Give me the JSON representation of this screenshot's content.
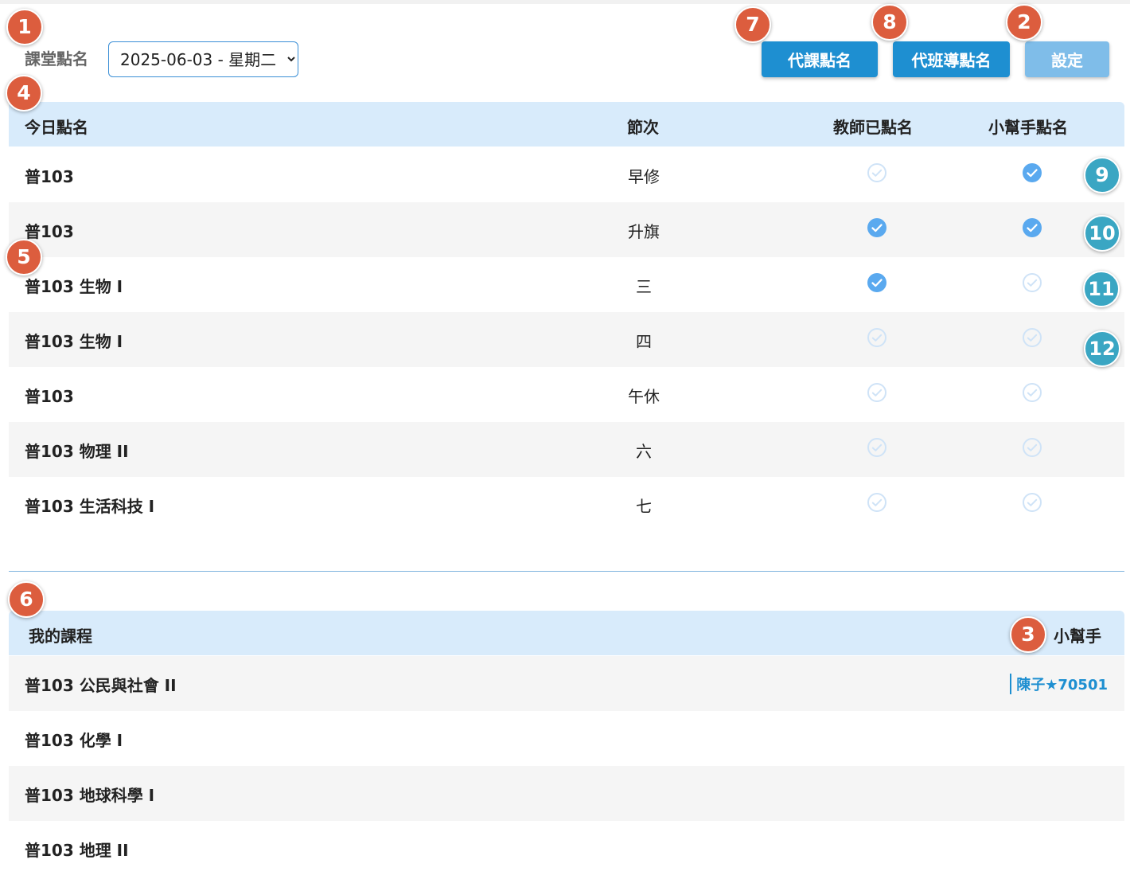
{
  "header": {
    "title": "課堂點名",
    "date_value": "2025-06-03 - 星期二",
    "buttons": {
      "substitute": "代課點名",
      "homeroom": "代班導點名",
      "settings": "設定"
    }
  },
  "markers": [
    "1",
    "2",
    "3",
    "4",
    "5",
    "6",
    "7",
    "8",
    "9",
    "10",
    "11",
    "12"
  ],
  "today": {
    "headers": {
      "course": "今日點名",
      "period": "節次",
      "teacher": "教師已點名",
      "helper": "小幫手點名"
    },
    "rows": [
      {
        "course": "普103",
        "period": "早修",
        "teacher_done": false,
        "helper_done": true
      },
      {
        "course": "普103",
        "period": "升旗",
        "teacher_done": true,
        "helper_done": true
      },
      {
        "course": "普103 生物 I",
        "period": "三",
        "teacher_done": true,
        "helper_done": false
      },
      {
        "course": "普103 生物 I",
        "period": "四",
        "teacher_done": false,
        "helper_done": false
      },
      {
        "course": "普103",
        "period": "午休",
        "teacher_done": false,
        "helper_done": false
      },
      {
        "course": "普103 物理 II",
        "period": "六",
        "teacher_done": false,
        "helper_done": false
      },
      {
        "course": "普103 生活科技 I",
        "period": "七",
        "teacher_done": false,
        "helper_done": false
      }
    ]
  },
  "courses": {
    "headers": {
      "course": "我的課程",
      "helper": "小幫手"
    },
    "rows": [
      {
        "course": "普103 公民與社會 II",
        "helper": "陳子★70501"
      },
      {
        "course": "普103 化學 I",
        "helper": ""
      },
      {
        "course": "普103 地球科學 I",
        "helper": ""
      },
      {
        "course": "普103 地理 II",
        "helper": ""
      }
    ]
  },
  "colors": {
    "primary": "#1e8fd1",
    "primary_light": "#7fbde9",
    "header_bg": "#d8ebfb",
    "check_on": "#5aa9ef",
    "check_off": "#cfe3f7",
    "marker_orange": "#dc5d3e",
    "marker_teal": "#3aa6c3"
  },
  "icons": {
    "checked": "check-circle-filled-icon",
    "unchecked": "check-circle-outline-icon"
  }
}
